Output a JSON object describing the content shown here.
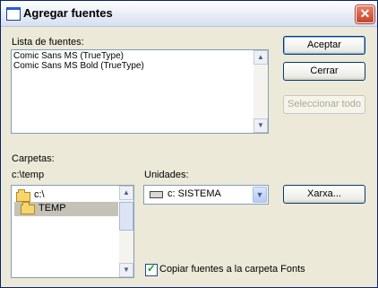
{
  "window": {
    "title": "Agregar fuentes",
    "close_glyph": "✕"
  },
  "fonts_list": {
    "label": "Lista de fuentes:",
    "items": [
      "Comic Sans MS (TrueType)",
      "Comic Sans MS Bold (TrueType)"
    ]
  },
  "buttons": {
    "accept": "Aceptar",
    "close": "Cerrar",
    "select_all": "Seleccionar todo",
    "network": "Xarxa..."
  },
  "folders": {
    "label": "Carpetas:",
    "current_path": "c:\\temp",
    "items": [
      "c:\\",
      "TEMP"
    ]
  },
  "drives": {
    "label": "Unidades:",
    "selected": "c: SISTEMA"
  },
  "copy_option": {
    "label": "Copiar fuentes a la carpeta Fonts",
    "checked": true
  },
  "icons": [
    "window-icon",
    "close-icon",
    "folder-open-icon",
    "drive-icon",
    "chevron-down-icon",
    "scroll-up-icon",
    "scroll-down-icon",
    "check-icon"
  ]
}
